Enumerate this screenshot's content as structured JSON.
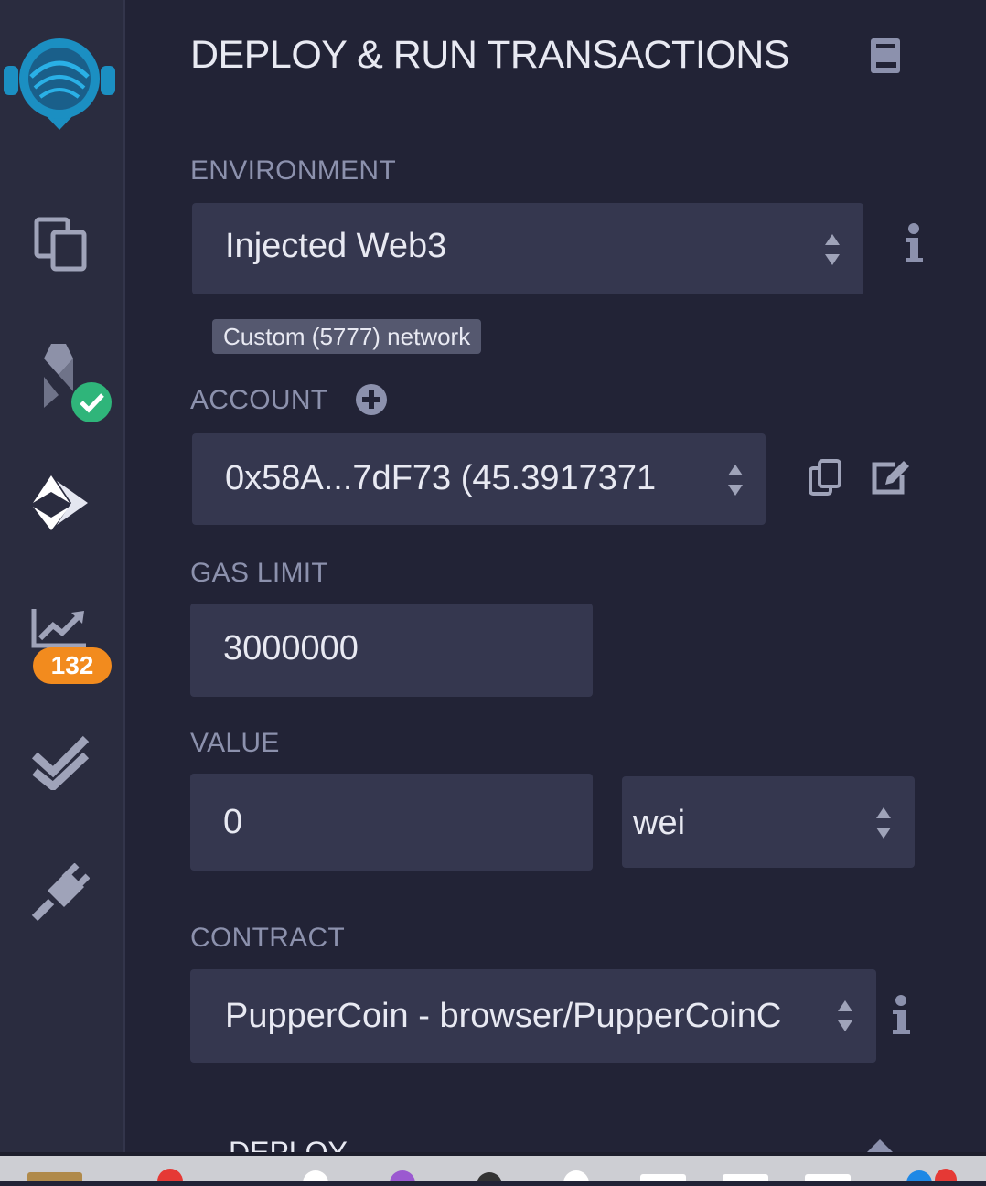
{
  "panel": {
    "title": "DEPLOY & RUN TRANSACTIONS",
    "icons": [
      "remix-logo-icon",
      "file-explorers-icon",
      "solidity-compiler-icon",
      "deploy-run-icon",
      "analysis-icon",
      "testing-icon",
      "plugin-manager-icon",
      "docs-book-icon"
    ],
    "analysis_badge": "132"
  },
  "environment": {
    "label": "ENVIRONMENT",
    "value": "Injected Web3",
    "network_badge": "Custom (5777) network"
  },
  "account": {
    "label": "ACCOUNT",
    "value": "0x58A...7dF73 (45.3917371"
  },
  "gas_limit": {
    "label": "GAS LIMIT",
    "value": "3000000"
  },
  "value": {
    "label": "VALUE",
    "amount": "0",
    "unit": "wei"
  },
  "contract": {
    "label": "CONTRACT",
    "value": "PupperCoin - browser/PupperCoinC"
  },
  "deploy": {
    "label": "DEPLOY"
  },
  "colors": {
    "background": "#222336",
    "sidebar": "#2a2c3f",
    "input": "#35374f",
    "accent": "#2b9ed1",
    "success": "#2fb57a",
    "badge": "#f28b1e"
  }
}
